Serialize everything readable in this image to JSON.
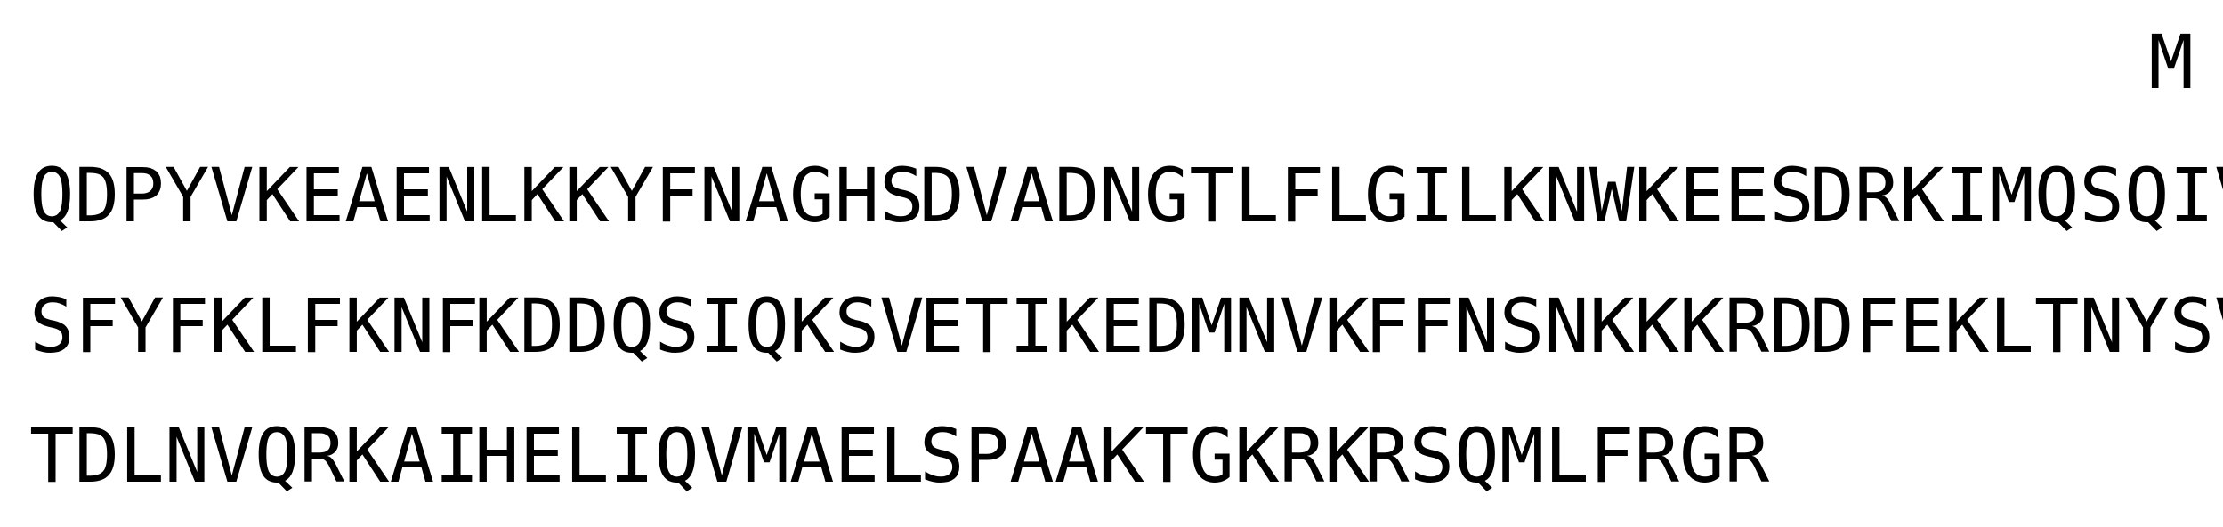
{
  "sequence": {
    "first_line": "M",
    "rows": [
      [
        "QDPYVKEAEN",
        "LKKYFNAGHS",
        "DVADNGTLFL",
        "GILKNWKEES",
        "DRKIMQSQIV"
      ],
      [
        "SFYFKLFKNF",
        "KDDQSIQKSV",
        "ETIKEDMNVK",
        "FFNSNKKKRD",
        "DFEKLTNYSV"
      ],
      [
        "TDLNVQRKAI",
        "HELIQVMAEL",
        "SPAAKTGKRK",
        "RSQMLFRGR"
      ]
    ]
  }
}
